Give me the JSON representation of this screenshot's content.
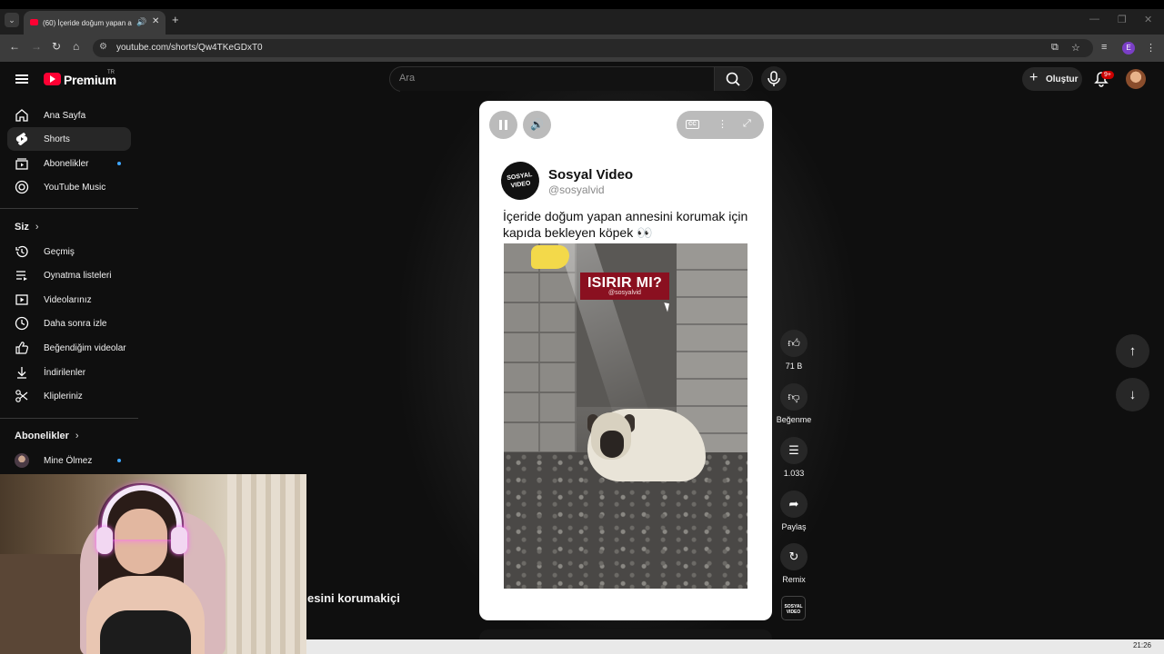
{
  "browser": {
    "tab_title": "(60) İçeride doğum yapan a",
    "url": "youtube.com/shorts/Qw4TKeGDxT0",
    "extension_initial": "E"
  },
  "header": {
    "logo_text": "Premium",
    "country_code": "TR",
    "search_placeholder": "Ara",
    "create_label": "Oluştur",
    "notification_count": "9+"
  },
  "sidebar": {
    "main": [
      {
        "label": "Ana Sayfa",
        "icon": "home-icon"
      },
      {
        "label": "Shorts",
        "icon": "shorts-icon",
        "active": true
      },
      {
        "label": "Abonelikler",
        "icon": "subscriptions-icon",
        "dot": true
      },
      {
        "label": "YouTube Music",
        "icon": "music-icon"
      }
    ],
    "you_heading": "Siz",
    "you_items": [
      {
        "label": "Geçmiş",
        "icon": "history-icon"
      },
      {
        "label": "Oynatma listeleri",
        "icon": "playlists-icon"
      },
      {
        "label": "Videolarınız",
        "icon": "your-videos-icon"
      },
      {
        "label": "Daha sonra izle",
        "icon": "watch-later-icon"
      },
      {
        "label": "Beğendiğim videolar",
        "icon": "liked-icon"
      },
      {
        "label": "İndirilenler",
        "icon": "download-icon"
      },
      {
        "label": "Klipleriniz",
        "icon": "clips-icon"
      }
    ],
    "subs_heading": "Abonelikler",
    "subs_items": [
      {
        "label": "Mine Ölmez",
        "dot": true
      }
    ]
  },
  "short": {
    "channel_name": "Sosyal Video",
    "channel_handle": "@sosyalvid",
    "channel_logo_text": "SOSYAL VIDEO",
    "caption": "İçeride doğum yapan annesini korumak için kapıda bekleyen köpek 👀",
    "overlay_title": "ISIRIR MI?",
    "overlay_handle": "@sosyalvid",
    "truncated_title": "esini korumakiçin ..."
  },
  "actions": {
    "likes": "71 B",
    "dislike_label": "Beğenme",
    "comments": "1.033",
    "share_label": "Paylaş",
    "remix_label": "Remix"
  },
  "taskbar": {
    "clock": "21:26"
  }
}
